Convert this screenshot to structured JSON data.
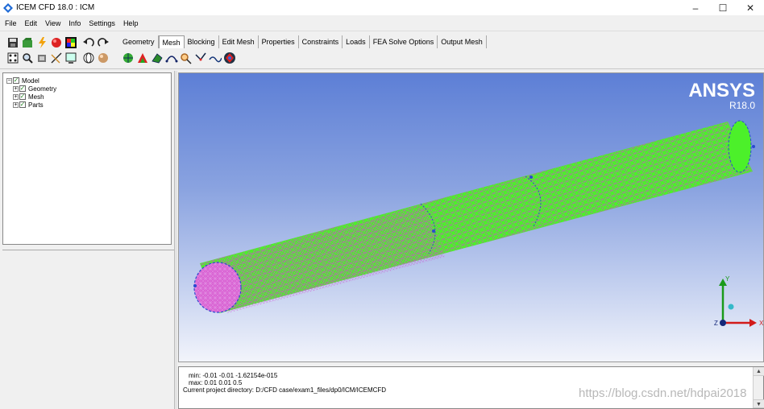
{
  "window": {
    "title": "ICEM CFD 18.0 : ICM",
    "minimize": "–",
    "maximize": "☐",
    "close": "✕"
  },
  "menu": [
    "File",
    "Edit",
    "View",
    "Info",
    "Settings",
    "Help"
  ],
  "tabs": [
    {
      "label": "Geometry",
      "active": false
    },
    {
      "label": "Mesh",
      "active": true
    },
    {
      "label": "Blocking",
      "active": false
    },
    {
      "label": "Edit Mesh",
      "active": false
    },
    {
      "label": "Properties",
      "active": false
    },
    {
      "label": "Constraints",
      "active": false
    },
    {
      "label": "Loads",
      "active": false
    },
    {
      "label": "FEA Solve Options",
      "active": false
    },
    {
      "label": "Output Mesh",
      "active": false
    }
  ],
  "toolbar_icons": {
    "row1": [
      "save-icon",
      "open-icon",
      "lightning-icon",
      "sphere-icon",
      "color-map-icon",
      "undo-icon",
      "redo-icon"
    ],
    "row2": [
      "fit-icon",
      "zoom-icon",
      "probe-icon",
      "measure-icon",
      "display-icon",
      "wireframe-icon",
      "solid-icon"
    ],
    "mesh_tab": [
      "global-mesh-setup-icon",
      "part-mesh-setup-icon",
      "surface-mesh-setup-icon",
      "curve-mesh-setup-icon",
      "create-mesh-density-icon",
      "connectors-icon",
      "mesh-curve-icon",
      "compute-mesh-icon"
    ]
  },
  "tree": {
    "root": "Model",
    "children": [
      {
        "label": "Geometry",
        "checked": true
      },
      {
        "label": "Mesh",
        "checked": true
      },
      {
        "label": "Parts",
        "checked": true
      }
    ]
  },
  "viewport": {
    "brand": "ANSYS",
    "version": "R18.0",
    "axis_labels": {
      "x": "X",
      "y": "Y",
      "z": "Z"
    }
  },
  "console": {
    "lines": [
      "min: -0.01 -0.01 -1.62154e-015",
      "max: 0.01 0.01 0.5",
      "Current project directory: D:/CFD case/exam1_files/dp0/ICM/ICEMCFD"
    ],
    "scroll_up": "▲",
    "scroll_down": "▼"
  },
  "watermark": "https://blog.csdn.net/hdpai2018",
  "colors": {
    "mesh_fill": "#4cf02a",
    "mesh_line": "#d04ad0",
    "edge": "#2a4ad0",
    "viewport_top": "#5d7fd6"
  }
}
